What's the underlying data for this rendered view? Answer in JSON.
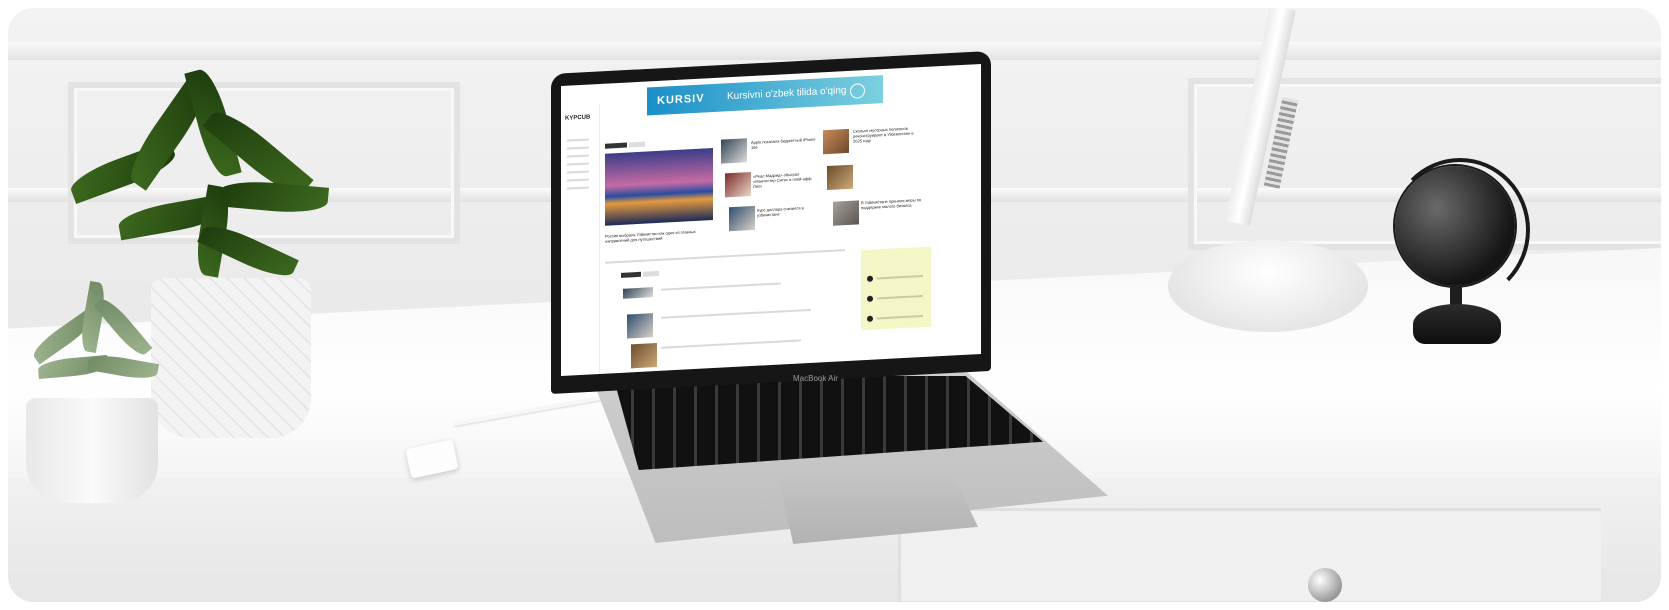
{
  "laptop": {
    "model_label": "MacBook Air"
  },
  "website": {
    "logo": "KYPCUB",
    "banner": {
      "logo": "KURSIV",
      "text": "Kursivni o'zbek tilida o'qing"
    },
    "headlines": [
      "Россия выбрала Узбекистан как одно из главных направлений для путешествий",
      "Apple показала бюджетный iPhone 16e",
      "«Реал Мадрид» обыграл «Манчестер Сити» в плей-офф Лиги",
      "Курс доллара снизился в узбекистане",
      "В Узбекистане приняли меры по поддержке малого бизнеса",
      "Сколько мусорных полигонов реконструируют в Узбекистане в 2025 году"
    ]
  }
}
